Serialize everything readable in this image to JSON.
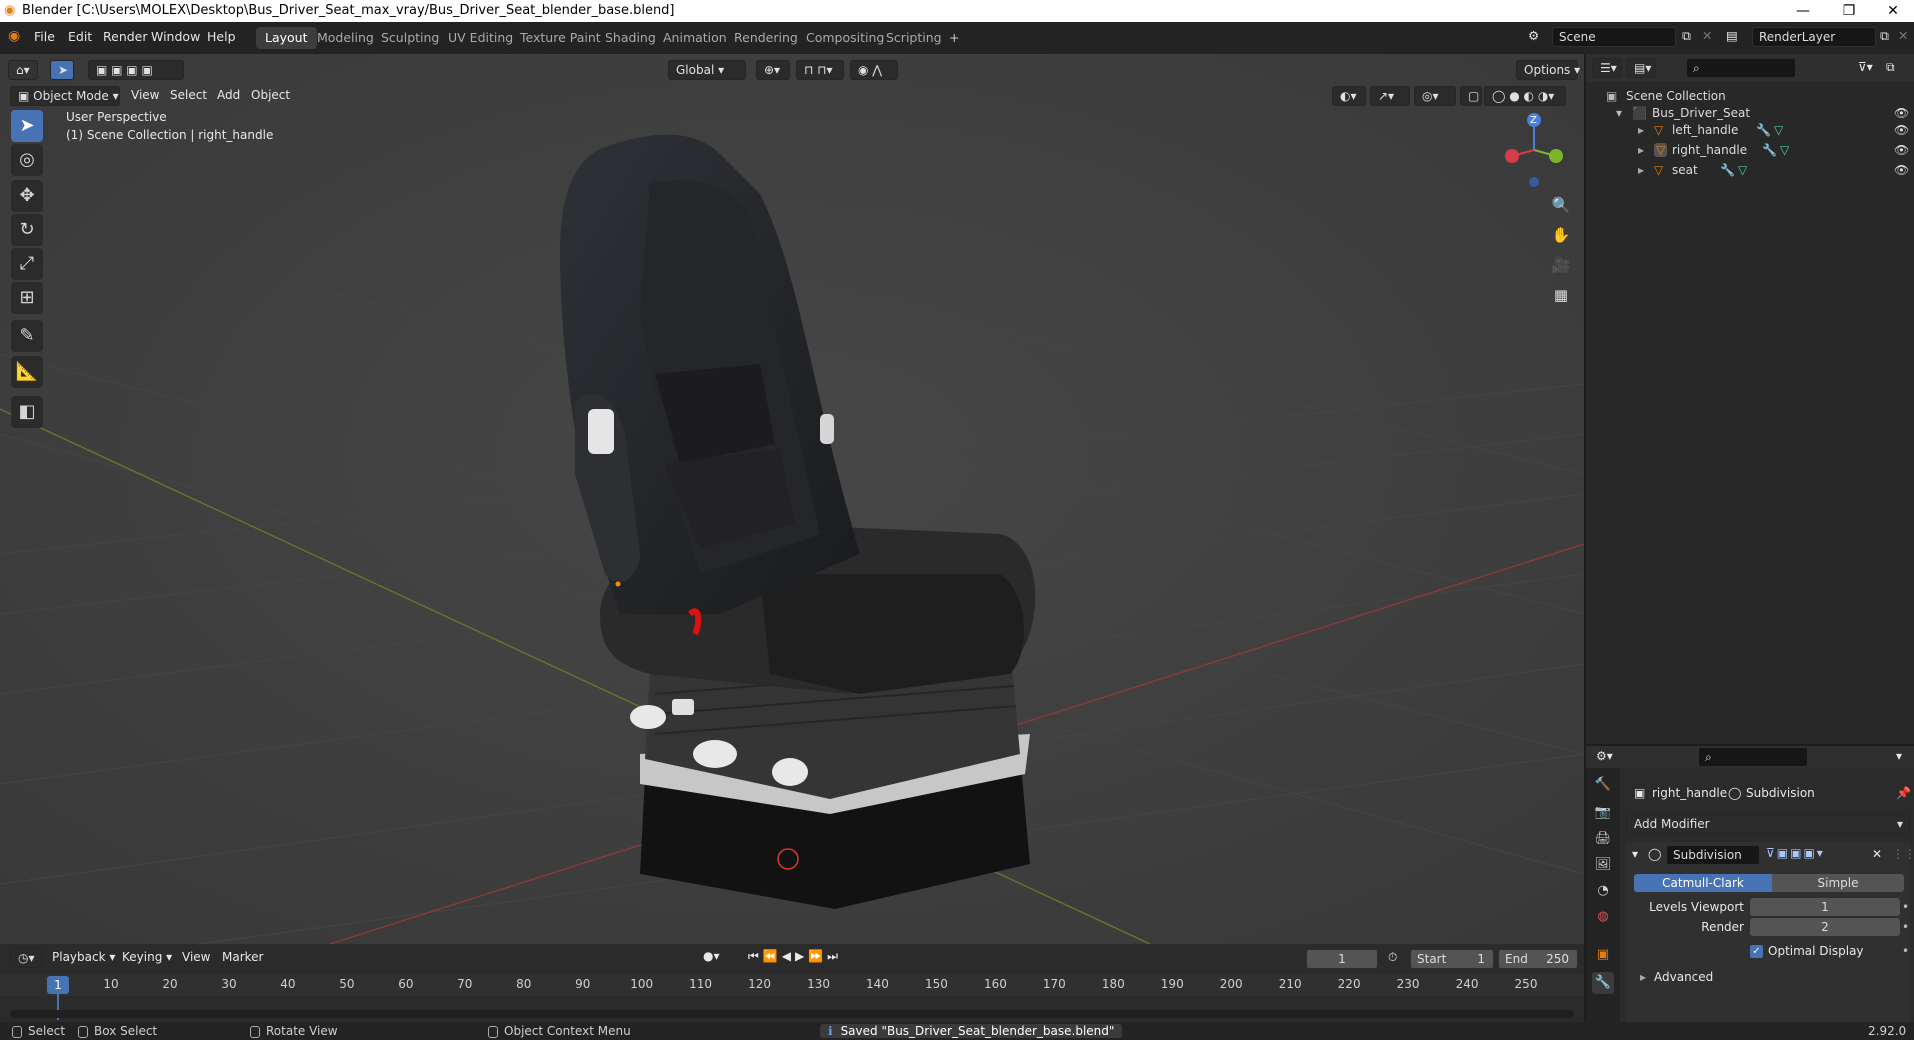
{
  "window": {
    "title": "Blender [C:\\Users\\MOLEX\\Desktop\\Bus_Driver_Seat_max_vray/Bus_Driver_Seat_blender_base.blend]"
  },
  "menus": [
    "File",
    "Edit",
    "Render",
    "Window",
    "Help"
  ],
  "workspaces": [
    "Layout",
    "Modeling",
    "Sculpting",
    "UV Editing",
    "Texture Paint",
    "Shading",
    "Animation",
    "Rendering",
    "Compositing",
    "Scripting"
  ],
  "active_workspace": "Layout",
  "scene": {
    "name": "Scene",
    "view_layer": "RenderLayer"
  },
  "viewport": {
    "transform_orientation": "Global",
    "options_label": "Options",
    "mode": "Object Mode",
    "header_menus": [
      "View",
      "Select",
      "Add",
      "Object"
    ],
    "perspective_label": "User Perspective",
    "collection_label": "(1) Scene Collection | right_handle",
    "gizmo_axis_label": "Z"
  },
  "outliner": {
    "root": "Scene Collection",
    "collection": "Bus_Driver_Seat",
    "objects": [
      {
        "name": "left_handle"
      },
      {
        "name": "right_handle"
      },
      {
        "name": "seat"
      }
    ]
  },
  "properties": {
    "object_name": "right_handle",
    "modifier_context": "Subdivision",
    "add_modifier_label": "Add Modifier",
    "modifier": {
      "name": "Subdivision",
      "types": [
        "Catmull-Clark",
        "Simple"
      ],
      "active_type": "Catmull-Clark",
      "levels_viewport_label": "Levels Viewport",
      "levels_viewport": "1",
      "render_label": "Render",
      "render": "2",
      "optimal_display_label": "Optimal Display",
      "optimal_display": true,
      "advanced_label": "Advanced"
    }
  },
  "timeline": {
    "menus": [
      "Playback",
      "Keying",
      "View",
      "Marker"
    ],
    "current_frame": "1",
    "start_label": "Start",
    "start": "1",
    "end_label": "End",
    "end": "250",
    "ticks": [
      "1",
      "10",
      "20",
      "30",
      "40",
      "50",
      "60",
      "70",
      "80",
      "90",
      "100",
      "110",
      "120",
      "130",
      "140",
      "150",
      "160",
      "170",
      "180",
      "190",
      "200",
      "210",
      "220",
      "230",
      "240",
      "250"
    ]
  },
  "status": {
    "select": "Select",
    "box_select": "Box Select",
    "rotate_view": "Rotate View",
    "context_menu": "Object Context Menu",
    "message": "Saved \"Bus_Driver_Seat_blender_base.blend\"",
    "version": "2.92.0"
  },
  "colors": {
    "accent": "#4772b3",
    "viewport_bg": "#3d3d3d",
    "panel_bg": "#2b2b2b",
    "orange": "#e87d0d"
  }
}
